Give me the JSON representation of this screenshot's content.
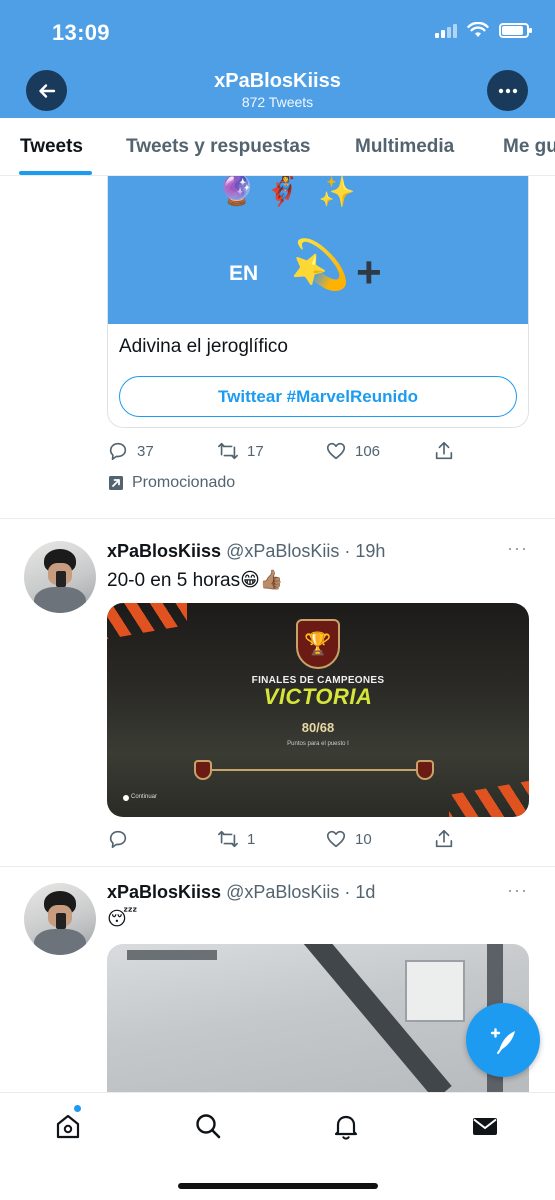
{
  "status_bar": {
    "time": "13:09"
  },
  "header": {
    "title": "xPaBlosKiiss",
    "subtitle": "872 Tweets",
    "back_icon": "arrow-left-icon",
    "more_icon": "more-horizontal-icon"
  },
  "tabs": [
    {
      "label": "Tweets",
      "active": true
    },
    {
      "label": "Tweets y respuestas",
      "active": false
    },
    {
      "label": "Multimedia",
      "active": false
    },
    {
      "label": "Me gu",
      "active": false
    }
  ],
  "promoted": {
    "card_image_text": "EN",
    "card_image_plus": "+",
    "card_emojis": [
      "🔮",
      "🦸‍♀️",
      "✨",
      "💫"
    ],
    "card_title": "Adivina el jeroglífico",
    "cta_label": "Twittear #MarvelReunido",
    "replies": "37",
    "retweets": "17",
    "likes": "106",
    "promo_label": "Promocionado"
  },
  "tweets": [
    {
      "name": "xPaBlosKiiss",
      "handle_time": "@xPaBlosKiis · 19h",
      "text": "20-0 en 5 horas😁👍🏽",
      "media": {
        "subtitle": "FINALES DE CAMPEONES",
        "title": "VICTORIA",
        "score": "80/68",
        "small_text": "Puntos para el puesto I",
        "continue_label": "Continuar"
      },
      "replies": "",
      "retweets": "1",
      "likes": "10"
    },
    {
      "name": "xPaBlosKiiss",
      "handle_time": "@xPaBlosKiis · 1d",
      "text": "😴"
    }
  ],
  "bottom_nav": [
    "home-icon",
    "search-icon",
    "notifications-bell-icon",
    "messages-mail-icon"
  ],
  "colors": {
    "accent": "#1d9bf0",
    "header_bg": "#4f9fe7",
    "secondary_text": "#536471"
  }
}
